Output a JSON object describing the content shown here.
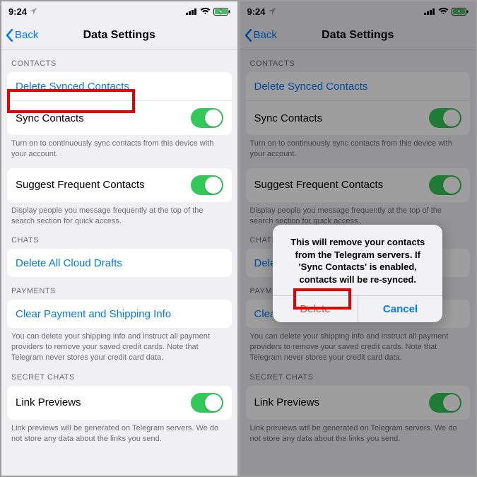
{
  "status": {
    "time": "9:24"
  },
  "nav": {
    "back": "Back",
    "title": "Data Settings"
  },
  "contacts": {
    "header": "CONTACTS",
    "delete_synced": "Delete Synced Contacts",
    "sync": "Sync Contacts",
    "sync_footer": "Turn on to continuously sync contacts from this device with your account."
  },
  "suggest": {
    "label": "Suggest Frequent Contacts",
    "footer": "Display people you message frequently at the top of the search section for quick access."
  },
  "chats": {
    "header": "CHATS",
    "delete_drafts": "Delete All Cloud Drafts"
  },
  "payments": {
    "header": "PAYMENTS",
    "clear": "Clear Payment and Shipping Info",
    "footer": "You can delete your shipping info and instruct all payment providers to remove your saved credit cards. Note that Telegram never stores your credit card data."
  },
  "secret": {
    "header": "SECRET CHATS",
    "link_previews": "Link Previews",
    "footer": "Link previews will be generated on Telegram servers. We do not store any data about the links you send."
  },
  "alert": {
    "message": "This will remove your contacts from the Telegram servers. If 'Sync Contacts' is enabled, contacts will be re-synced.",
    "delete": "Delete",
    "cancel": "Cancel"
  }
}
